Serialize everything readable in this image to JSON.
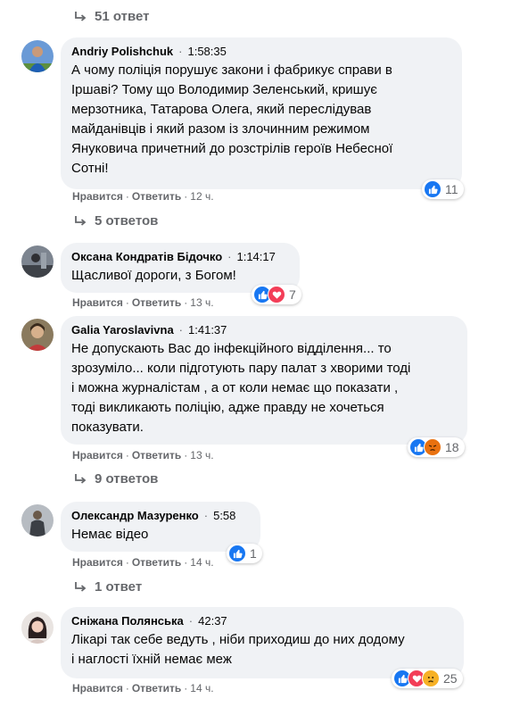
{
  "colors": {
    "like": "#1877f2",
    "love": "#f33e58",
    "angry": "#e9710f",
    "sad": "#f7b125",
    "link": "#65676b"
  },
  "top_replies": {
    "label": "51 ответ"
  },
  "actions": {
    "like": "Нравится",
    "reply": "Ответить"
  },
  "comments": [
    {
      "author": "Andriy Polishchuk",
      "time": "1:58:35",
      "text": "А чому поліція порушує закони і фабрикує справи в\nІршаві? Тому що Володимир Зеленський, кришує\nмерзотника, Татарова Олега, який переслідував\nмайданівців і який разом із злочинним режимом\nЯнуковича причетний до розстрілів героїв Небесної\nСотні!",
      "age": "12 ч.",
      "reactions": [
        "like-icon"
      ],
      "reaction_count": "11",
      "replies": "5 ответов"
    },
    {
      "author": "Оксана Кондратів Бідочко",
      "time": "1:14:17",
      "text": "Щасливої дороги, з Богом!",
      "age": "13 ч.",
      "reactions": [
        "like-icon",
        "love-icon"
      ],
      "reaction_count": "7",
      "replies": ""
    },
    {
      "author": "Galia Yaroslavivna",
      "time": "1:41:37",
      "text": "Не допускають Вас до інфекційного відділення... то\nзрозуміло... коли підготують пару палат з хворими тоді\nі можна журналістам , а от коли немає що показати ,\nтоді викликають поліцію, адже правду не хочеться\nпоказувати.",
      "age": "13 ч.",
      "reactions": [
        "like-icon",
        "angry-icon"
      ],
      "reaction_count": "18",
      "replies": "9 ответов"
    },
    {
      "author": "Олександр Мазуренко",
      "time": "5:58",
      "text": "Немає відео",
      "age": "14 ч.",
      "reactions": [
        "like-icon"
      ],
      "reaction_count": "1",
      "replies": "1 ответ"
    },
    {
      "author": "Сніжана Полянська",
      "time": "42:37",
      "text": "Лікарі так себе ведуть , ніби приходиш до них додому\nі наглості їхній немає меж",
      "age": "14 ч.",
      "reactions": [
        "like-icon",
        "love-icon",
        "sad-icon"
      ],
      "reaction_count": "25",
      "replies": ""
    }
  ]
}
